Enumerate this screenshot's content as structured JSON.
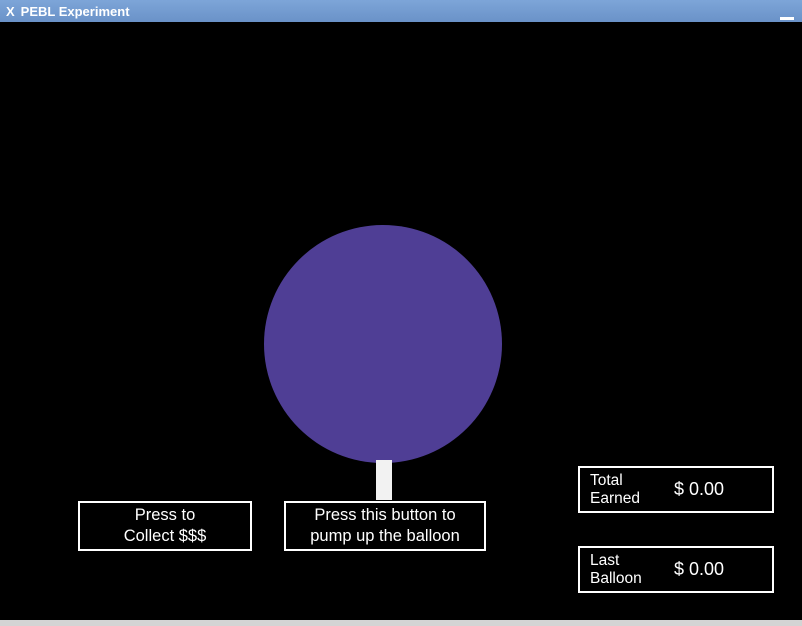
{
  "window": {
    "title": "PEBL Experiment"
  },
  "buttons": {
    "collect_label": "Press to\nCollect $$$",
    "pump_label": "Press this button to\npump up the balloon"
  },
  "earnings": {
    "total_label": "Total\nEarned",
    "total_value": "$ 0.00",
    "last_label": "Last\nBalloon",
    "last_value": "$ 0.00"
  },
  "balloon": {
    "color": "#4f3e95"
  }
}
